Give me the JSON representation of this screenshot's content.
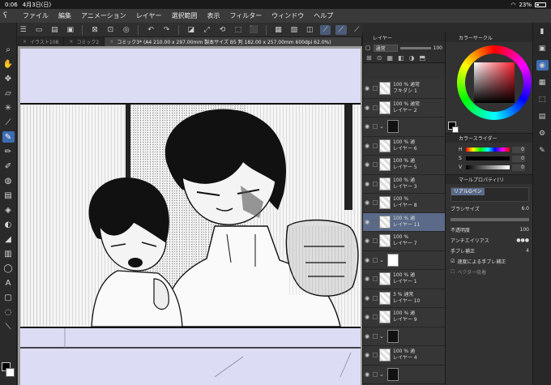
{
  "status": {
    "time": "0:06",
    "date": "4月3日(日)",
    "battery": "23%"
  },
  "menu": [
    "ファイル",
    "編集",
    "アニメーション",
    "レイヤー",
    "選択範囲",
    "表示",
    "フィルター",
    "ウィンドウ",
    "ヘルプ"
  ],
  "tabs": [
    {
      "label": "イラスト108"
    },
    {
      "label": "コミック2"
    },
    {
      "label": "コミック3* (A4 210.00 x 297.00mm 製本サイズ B5 判 182.00 x 257.00mm 600dpi 62.0%)"
    }
  ],
  "layer_panel": {
    "title": "レイヤー",
    "blend_mode": "通常",
    "opacity": "100",
    "layers": [
      {
        "line1": "100 % 通常",
        "line2": "フキダシ 1",
        "thumb": "checker",
        "folder": false,
        "selected": false
      },
      {
        "line1": "100 % 通常",
        "line2": "レイヤー 2",
        "thumb": "checker",
        "folder": false,
        "selected": false
      },
      {
        "line1": "",
        "line2": "",
        "thumb": "black",
        "folder": true,
        "selected": false
      },
      {
        "line1": "100 % 通",
        "line2": "レイヤー 6",
        "thumb": "checker",
        "folder": false,
        "selected": false
      },
      {
        "line1": "100 % 通",
        "line2": "レイヤー 5",
        "thumb": "checker",
        "folder": false,
        "selected": false
      },
      {
        "line1": "100 % 通",
        "line2": "レイヤー 3",
        "thumb": "checker",
        "folder": false,
        "selected": false
      },
      {
        "line1": "100 %",
        "line2": "レイヤー 8",
        "thumb": "checker",
        "folder": false,
        "selected": false
      },
      {
        "line1": "100 % 通",
        "line2": "レイヤー 11",
        "thumb": "checker",
        "folder": false,
        "selected": true
      },
      {
        "line1": "100 %",
        "line2": "レイヤー 7",
        "thumb": "checker",
        "folder": false,
        "selected": false
      },
      {
        "line1": "",
        "line2": "",
        "thumb": "white",
        "folder": true,
        "selected": false
      },
      {
        "line1": "100 % 通",
        "line2": "レイヤー 1",
        "thumb": "checker",
        "folder": false,
        "selected": false
      },
      {
        "line1": "3 % 通常",
        "line2": "レイヤー 10",
        "thumb": "checker",
        "folder": false,
        "selected": false
      },
      {
        "line1": "100 % 通",
        "line2": "レイヤー 9",
        "thumb": "checker",
        "folder": false,
        "selected": false
      },
      {
        "line1": "",
        "line2": "",
        "thumb": "black",
        "folder": true,
        "selected": false
      },
      {
        "line1": "100 % 通",
        "line2": "レイヤー 4",
        "thumb": "checker",
        "folder": false,
        "selected": false
      },
      {
        "line1": "",
        "line2": "",
        "thumb": "black",
        "folder": true,
        "selected": false
      },
      {
        "line1": "100 % 通",
        "line2": "レイヤー 4",
        "thumb": "checker",
        "folder": false,
        "selected": false
      }
    ]
  },
  "color_panel": {
    "title": "カラーサークル",
    "slider_title": "カラースライダー",
    "h": "0",
    "s": "0",
    "v": "0"
  },
  "tool_property": {
    "title": "マールプロパティ(リ",
    "brush": "リアルGペン",
    "brush_size_label": "ブラシサイズ",
    "brush_size": "6.0",
    "opacity_label": "不透明度",
    "opacity": "100",
    "antialias_label": "アンチエイリアス",
    "stabilization_label": "手ブレ補正",
    "stabilization": "4",
    "speed_label": "速度による手ブレ補正",
    "vector_label": "ベクター吸着"
  },
  "colors": {
    "accent": "#3d6cb3",
    "layer_selected": "#5a6a88",
    "page_bg": "#dcdcf4"
  }
}
